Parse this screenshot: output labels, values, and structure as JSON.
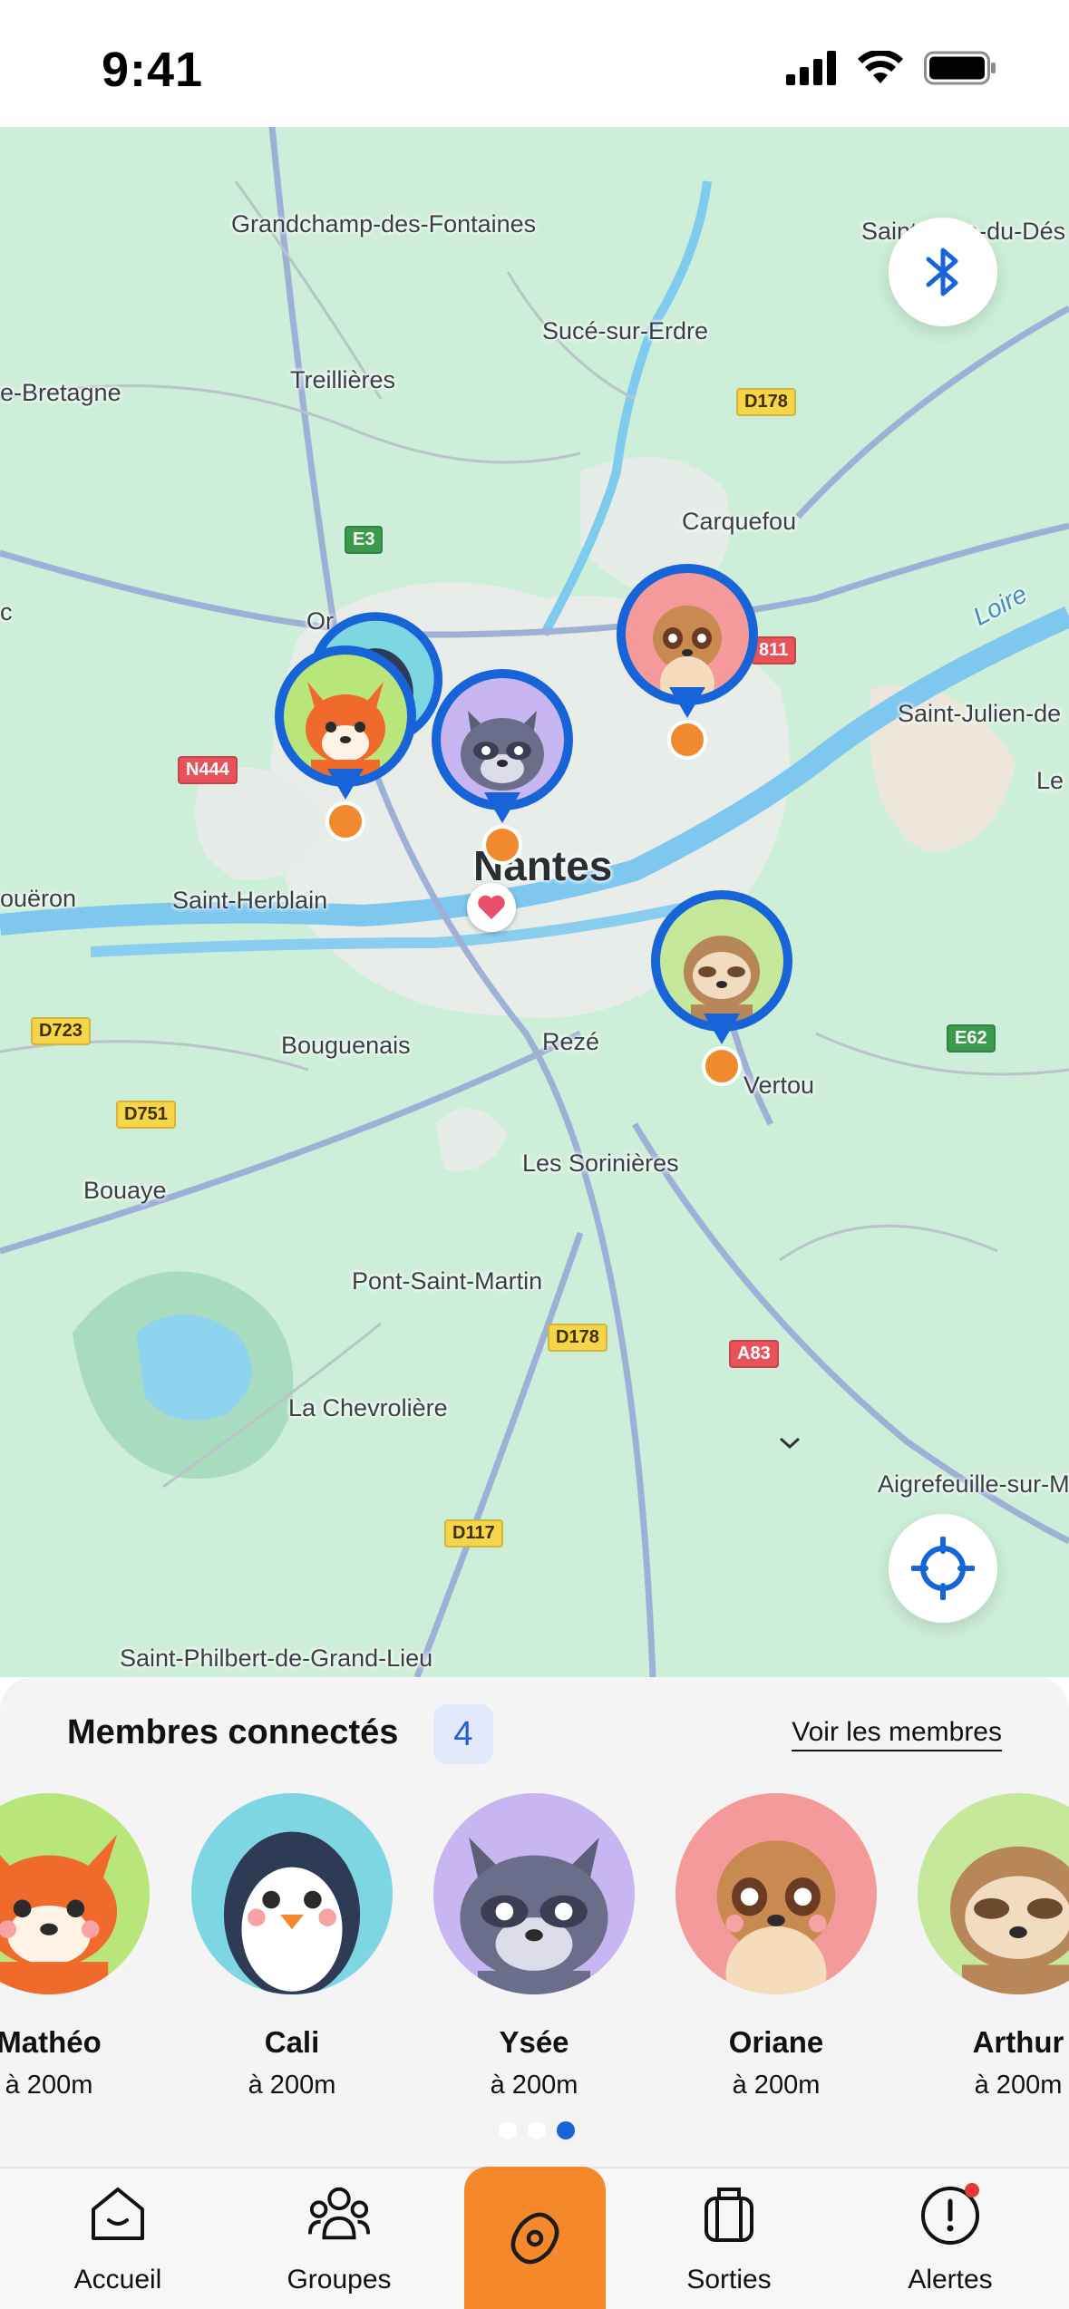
{
  "status_bar": {
    "time": "9:41"
  },
  "map": {
    "places": {
      "grandchamp": "Grandchamp-des-Fontaines",
      "sainte_luce": "Saint-Luce-du-Dés",
      "suce": "Sucé-sur-Erdre",
      "bretagne": "e-Bretagne",
      "treillieres": "Treillières",
      "carquefou": "Carquefou",
      "loire": "Loire",
      "orvault": "Or",
      "saint_julien": "Saint-Julien-de",
      "le": "Le",
      "nantes": "Nantes",
      "coueron": "ouëron",
      "saint_herblain": "Saint-Herblain",
      "bouguenais": "Bouguenais",
      "reze": "Rezé",
      "vertou": "Vertou",
      "bouaye": "Bouaye",
      "les_sorinieres": "Les Sorinières",
      "pont_saint_martin": "Pont-Saint-Martin",
      "la_chevroliere": "La Chevrolière",
      "aigrefeuille": "Aigrefeuille-sur-M",
      "saint_philbert": "Saint-Philbert-de-Grand-Lieu",
      "c": "c"
    },
    "roads": {
      "d178_top": "D178",
      "e3": "E3",
      "n444": "N444",
      "a811": "811",
      "d723": "D723",
      "d751": "D751",
      "e62": "E62",
      "d178_bottom": "D178",
      "a83": "A83",
      "d117": "D117"
    }
  },
  "members_panel": {
    "title": "Membres connectés",
    "count": "4",
    "link": "Voir les membres",
    "members": [
      {
        "name": "Mathéo",
        "distance": "à 200m"
      },
      {
        "name": "Cali",
        "distance": "à 200m"
      },
      {
        "name": "Ysée",
        "distance": "à 200m"
      },
      {
        "name": "Oriane",
        "distance": "à 200m"
      },
      {
        "name": "Arthur",
        "distance": "à 200m"
      }
    ]
  },
  "tabs": {
    "home": "Accueil",
    "groups": "Groupes",
    "outings": "Sorties",
    "alerts": "Alertes"
  },
  "colors": {
    "accent_blue": "#1764d9",
    "accent_orange": "#f5882b",
    "alert_red": "#e53935"
  },
  "icons": {
    "bluetooth": "bluetooth-icon",
    "locate": "crosshair-icon",
    "compass": "compass-icon"
  }
}
